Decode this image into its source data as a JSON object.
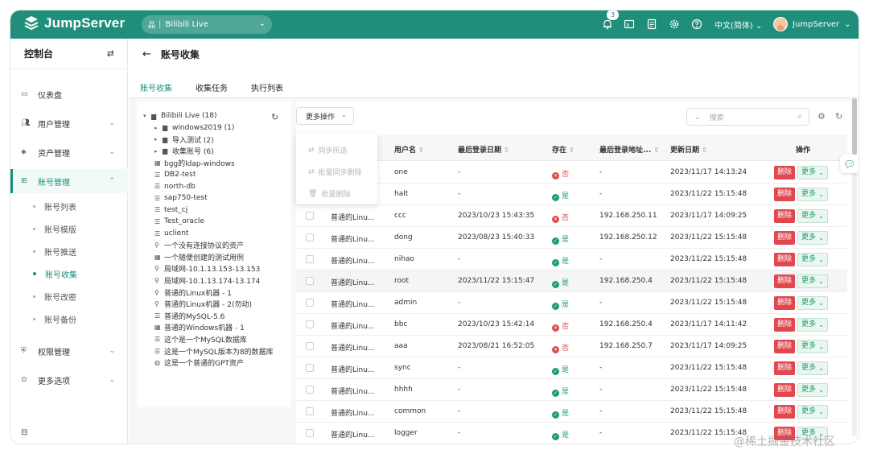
{
  "topbar": {
    "logo_text": "JumpServer",
    "org": {
      "icon": "品",
      "separator": "|",
      "name": "Bilibili Live"
    },
    "notification_count": "3",
    "language": "中文(简体)",
    "username": "JumpServer",
    "accent_color": "#1f8f7b"
  },
  "sidebar": {
    "title": "控制台",
    "items": [
      {
        "label": "仪表盘",
        "icon": "dashboard-icon"
      },
      {
        "label": "用户管理",
        "icon": "users-icon",
        "expandable": true
      },
      {
        "label": "资产管理",
        "icon": "assets-icon",
        "expandable": true
      },
      {
        "label": "账号管理",
        "icon": "account-icon",
        "expandable": true,
        "expanded": true
      },
      {
        "label": "权限管理",
        "icon": "shield-icon",
        "expandable": true
      },
      {
        "label": "更多选项",
        "icon": "more-icon",
        "expandable": true
      }
    ],
    "subitems": [
      {
        "label": "账号列表"
      },
      {
        "label": "账号模版"
      },
      {
        "label": "账号推送"
      },
      {
        "label": "账号收集",
        "active": true
      },
      {
        "label": "账号改密"
      },
      {
        "label": "账号备份"
      }
    ]
  },
  "page": {
    "title": "账号收集",
    "tabs": [
      "账号收集",
      "收集任务",
      "执行列表"
    ]
  },
  "tree": {
    "nodes": [
      {
        "label": "Bilibili Live (18)",
        "level": 0,
        "toggle": "open",
        "icon": "folder"
      },
      {
        "label": "windows2019 (1)",
        "level": 1,
        "toggle": "closed",
        "icon": "folder"
      },
      {
        "label": "导入测试 (2)",
        "level": 1,
        "toggle": "closed",
        "icon": "folder"
      },
      {
        "label": "收集账号 (6)",
        "level": 1,
        "toggle": "closed",
        "icon": "folder"
      },
      {
        "label": "bgg的ldap-windows",
        "level": 1,
        "icon": "windows"
      },
      {
        "label": "DB2-test",
        "level": 1,
        "icon": "db"
      },
      {
        "label": "north-db",
        "level": 1,
        "icon": "db"
      },
      {
        "label": "sap750-test",
        "level": 1,
        "icon": "db"
      },
      {
        "label": "test_cj",
        "level": 1,
        "icon": "db"
      },
      {
        "label": "Test_oracle",
        "level": 1,
        "icon": "db"
      },
      {
        "label": "uclient",
        "level": 1,
        "icon": "db"
      },
      {
        "label": "一个没有连接协议的资产",
        "level": 1,
        "icon": "linux"
      },
      {
        "label": "一个随便创建的测试用例",
        "level": 1,
        "icon": "windows"
      },
      {
        "label": "局域网-10.1.13.153-13.153",
        "level": 1,
        "icon": "linux"
      },
      {
        "label": "局域网-10.1.13.174-13.174",
        "level": 1,
        "icon": "linux"
      },
      {
        "label": "普通的Linux机器 - 1",
        "level": 1,
        "icon": "linux"
      },
      {
        "label": "普通的Linux机器 - 2(勿动)",
        "level": 1,
        "icon": "linux"
      },
      {
        "label": "普通的MySQL-5.6",
        "level": 1,
        "icon": "db"
      },
      {
        "label": "普通的Windows机器 - 1",
        "level": 1,
        "icon": "windows"
      },
      {
        "label": "这个是一个MySQL数据库",
        "level": 1,
        "icon": "db"
      },
      {
        "label": "这是一个MySQL版本为8的数据库",
        "level": 1,
        "icon": "db"
      },
      {
        "label": "这是一个普通的GPT资产",
        "level": 1,
        "icon": "gpt"
      }
    ]
  },
  "toolbar": {
    "more_ops_label": "更多操作",
    "dropdown": [
      "同步所选",
      "批量同步删除",
      "批量删除"
    ],
    "search_placeholder": "搜索"
  },
  "table": {
    "columns": [
      "用户名",
      "最后登录日期",
      "存在",
      "最后登录地址...",
      "更新日期",
      "操作"
    ],
    "delete_label": "删除",
    "more_label": "更多",
    "yes_label": "是",
    "no_label": "否",
    "rows": [
      {
        "asset": "",
        "username": "one",
        "last_login": "-",
        "exists": false,
        "address": "-",
        "updated": "2023/11/17 14:13:24"
      },
      {
        "asset": "",
        "username": "halt",
        "last_login": "-",
        "exists": true,
        "address": "-",
        "updated": "2023/11/22 15:15:48"
      },
      {
        "asset": "普通的Linu...",
        "username": "ccc",
        "last_login": "2023/10/23 15:43:35",
        "exists": false,
        "address": "192.168.250.11",
        "updated": "2023/11/17 14:09:25"
      },
      {
        "asset": "普通的Linu...",
        "username": "dong",
        "last_login": "2023/08/23 15:40:33",
        "exists": true,
        "address": "192.168.250.12",
        "updated": "2023/11/22 15:15:48"
      },
      {
        "asset": "普通的Linu...",
        "username": "nihao",
        "last_login": "-",
        "exists": true,
        "address": "-",
        "updated": "2023/11/22 15:15:48"
      },
      {
        "asset": "普通的Linu...",
        "username": "root",
        "last_login": "2023/11/22 15:15:47",
        "exists": true,
        "address": "192.168.250.4",
        "updated": "2023/11/22 15:15:48",
        "highlight": true
      },
      {
        "asset": "普通的Linu...",
        "username": "admin",
        "last_login": "-",
        "exists": true,
        "address": "-",
        "updated": "2023/11/22 15:15:48"
      },
      {
        "asset": "普通的Linu...",
        "username": "bbc",
        "last_login": "2023/10/23 15:42:14",
        "exists": false,
        "address": "192.168.250.4",
        "updated": "2023/11/17 14:11:42"
      },
      {
        "asset": "普通的Linu...",
        "username": "aaa",
        "last_login": "2023/08/21 16:52:05",
        "exists": false,
        "address": "192.168.250.7",
        "updated": "2023/11/17 14:09:25"
      },
      {
        "asset": "普通的Linu...",
        "username": "sync",
        "last_login": "-",
        "exists": true,
        "address": "-",
        "updated": "2023/11/22 15:15:48"
      },
      {
        "asset": "普通的Linu...",
        "username": "hhhh",
        "last_login": "-",
        "exists": true,
        "address": "-",
        "updated": "2023/11/22 15:15:48"
      },
      {
        "asset": "普通的Linu...",
        "username": "common",
        "last_login": "-",
        "exists": true,
        "address": "-",
        "updated": "2023/11/22 15:15:48"
      },
      {
        "asset": "普通的Linu...",
        "username": "logger",
        "last_login": "-",
        "exists": true,
        "address": "-",
        "updated": "2023/11/22 15:15:48"
      }
    ]
  },
  "watermark": "@稀土掘金技术社区"
}
